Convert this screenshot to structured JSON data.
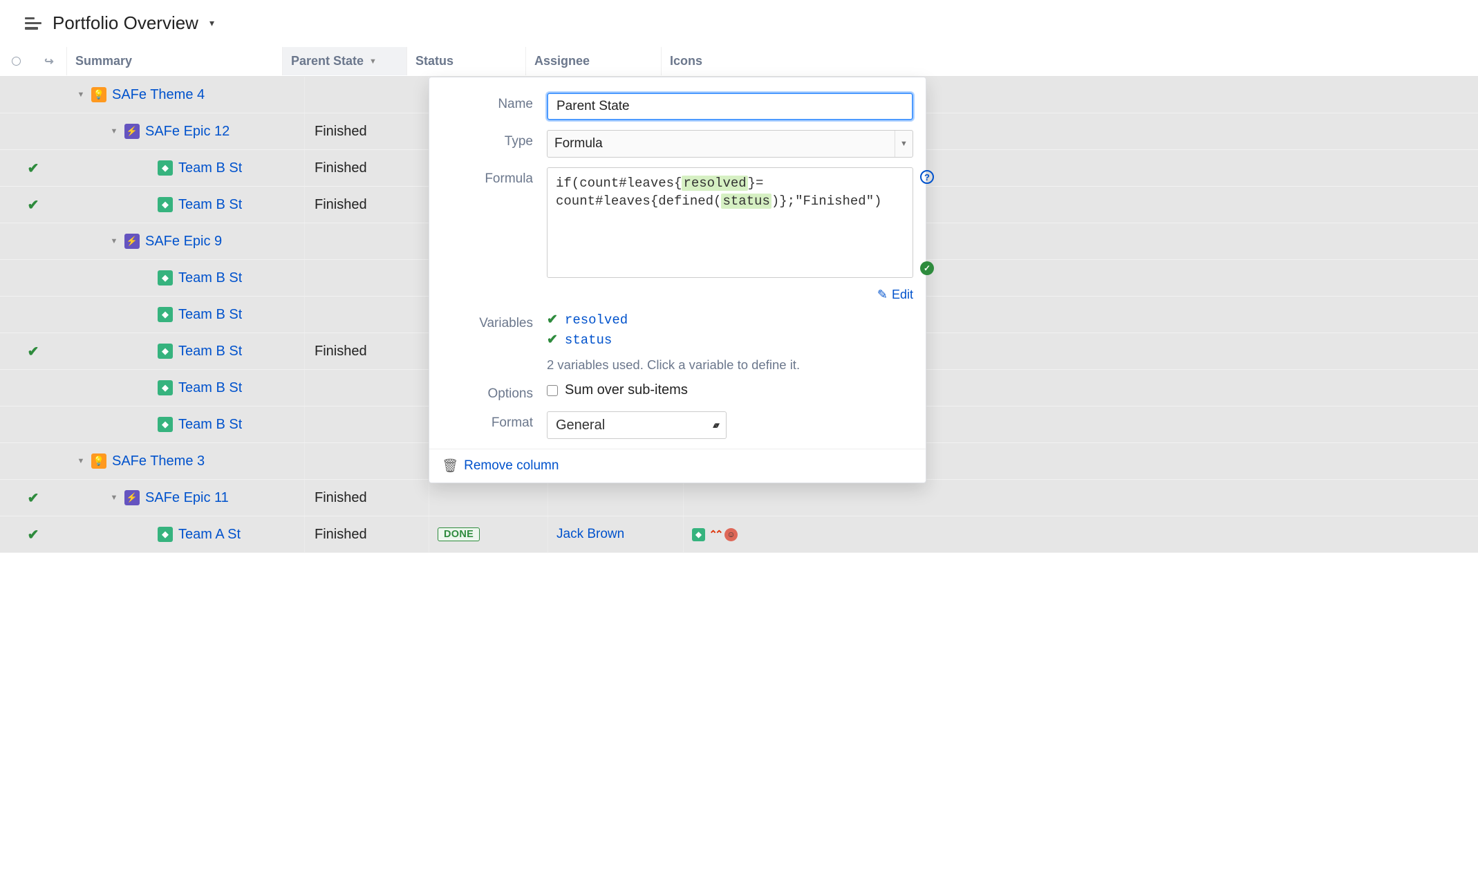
{
  "header": {
    "title": "Portfolio Overview"
  },
  "columns": {
    "summary": "Summary",
    "parent_state": "Parent State",
    "status": "Status",
    "assignee": "Assignee",
    "icons": "Icons"
  },
  "rows": [
    {
      "indent": 0,
      "exp": true,
      "type": "theme",
      "title": "SAFe Theme 4",
      "parent": "",
      "checked": false
    },
    {
      "indent": 1,
      "exp": true,
      "type": "epic",
      "title": "SAFe Epic 12",
      "parent": "Finished",
      "checked": false
    },
    {
      "indent": 2,
      "exp": false,
      "type": "story",
      "title": "Team B St",
      "parent": "Finished",
      "checked": true
    },
    {
      "indent": 2,
      "exp": false,
      "type": "story",
      "title": "Team B St",
      "parent": "Finished",
      "checked": true
    },
    {
      "indent": 1,
      "exp": true,
      "type": "epic",
      "title": "SAFe Epic 9",
      "parent": "",
      "checked": false
    },
    {
      "indent": 2,
      "exp": false,
      "type": "story",
      "title": "Team B St",
      "parent": "",
      "checked": false
    },
    {
      "indent": 2,
      "exp": false,
      "type": "story",
      "title": "Team B St",
      "parent": "",
      "checked": false
    },
    {
      "indent": 2,
      "exp": false,
      "type": "story",
      "title": "Team B St",
      "parent": "Finished",
      "checked": true
    },
    {
      "indent": 2,
      "exp": false,
      "type": "story",
      "title": "Team B St",
      "parent": "",
      "checked": false
    },
    {
      "indent": 2,
      "exp": false,
      "type": "story",
      "title": "Team B St",
      "parent": "",
      "checked": false
    },
    {
      "indent": 0,
      "exp": true,
      "type": "theme",
      "title": "SAFe Theme 3",
      "parent": "",
      "checked": false
    },
    {
      "indent": 1,
      "exp": true,
      "type": "epic",
      "title": "SAFe Epic 11",
      "parent": "Finished",
      "checked": true
    },
    {
      "indent": 2,
      "exp": false,
      "type": "story",
      "title": "Team A St",
      "parent": "Finished",
      "checked": true,
      "status": "DONE",
      "assignee": "Jack Brown",
      "show_icons": true
    }
  ],
  "panel": {
    "labels": {
      "name": "Name",
      "type": "Type",
      "formula": "Formula",
      "variables": "Variables",
      "options": "Options",
      "format": "Format"
    },
    "name_value": "Parent State",
    "type_value": "Formula",
    "formula_raw": {
      "pre1": "if(count#leaves{",
      "hl1": "resolved",
      "mid1": "}=",
      "pre2": "count#leaves{defined(",
      "hl2": "status",
      "post2": ")};\"Finished\")"
    },
    "edit_label": "Edit",
    "variables": [
      "resolved",
      "status"
    ],
    "variables_help": "2 variables used. Click a variable to define it.",
    "options_label": "Sum over sub-items",
    "format_value": "General",
    "remove_label": "Remove column"
  }
}
